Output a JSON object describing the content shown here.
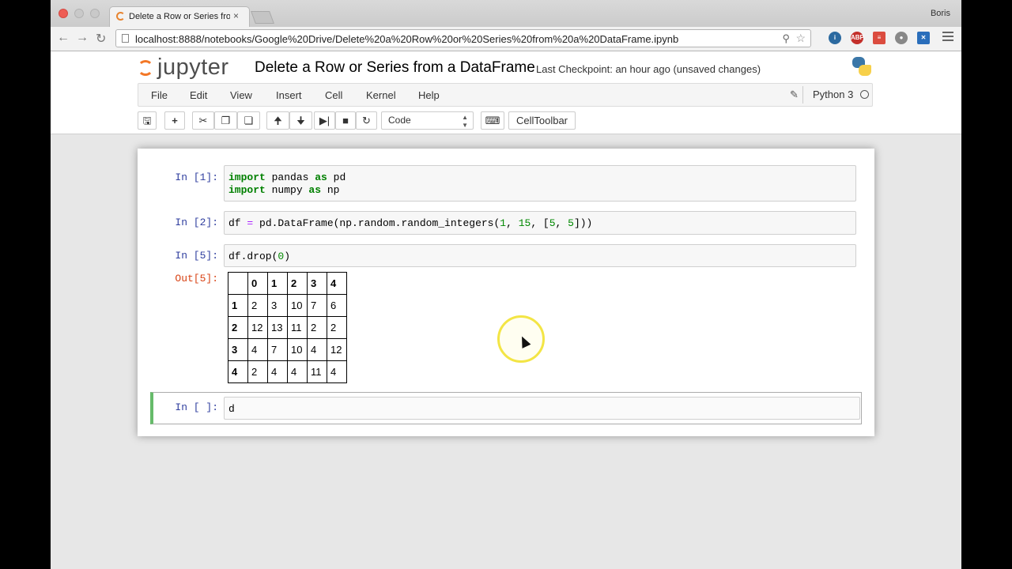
{
  "browser": {
    "tab_title": "Delete a Row or Series from",
    "tab_close": "×",
    "user": "Boris",
    "url": "localhost:8888/notebooks/Google%20Drive/Delete%20a%20Row%20or%20Series%20from%20a%20DataFrame.ipynb",
    "ext_abp": "ABP"
  },
  "header": {
    "logo_text": "jupyter",
    "notebook_title": "Delete a Row or Series from a DataFrame",
    "checkpoint": "Last Checkpoint: an hour ago (unsaved changes)"
  },
  "menu": {
    "items": [
      "File",
      "Edit",
      "View",
      "Insert",
      "Cell",
      "Kernel",
      "Help"
    ],
    "kernel": "Python 3"
  },
  "toolbar": {
    "cell_type": "Code",
    "celltoolbar_label": "CellToolbar"
  },
  "cells": {
    "c1": {
      "prompt": "In [1]:"
    },
    "c2": {
      "prompt": "In [2]:"
    },
    "c3": {
      "prompt": "In [5]:",
      "out_prompt": "Out[5]:"
    },
    "c4": {
      "prompt": "In [ ]:",
      "code": "d"
    }
  },
  "df_output": {
    "columns": [
      "",
      "0",
      "1",
      "2",
      "3",
      "4"
    ],
    "rows": [
      [
        "1",
        "2",
        "3",
        "10",
        "7",
        "6"
      ],
      [
        "2",
        "12",
        "13",
        "11",
        "2",
        "2"
      ],
      [
        "3",
        "4",
        "7",
        "10",
        "4",
        "12"
      ],
      [
        "4",
        "2",
        "4",
        "4",
        "11",
        "4"
      ]
    ]
  }
}
